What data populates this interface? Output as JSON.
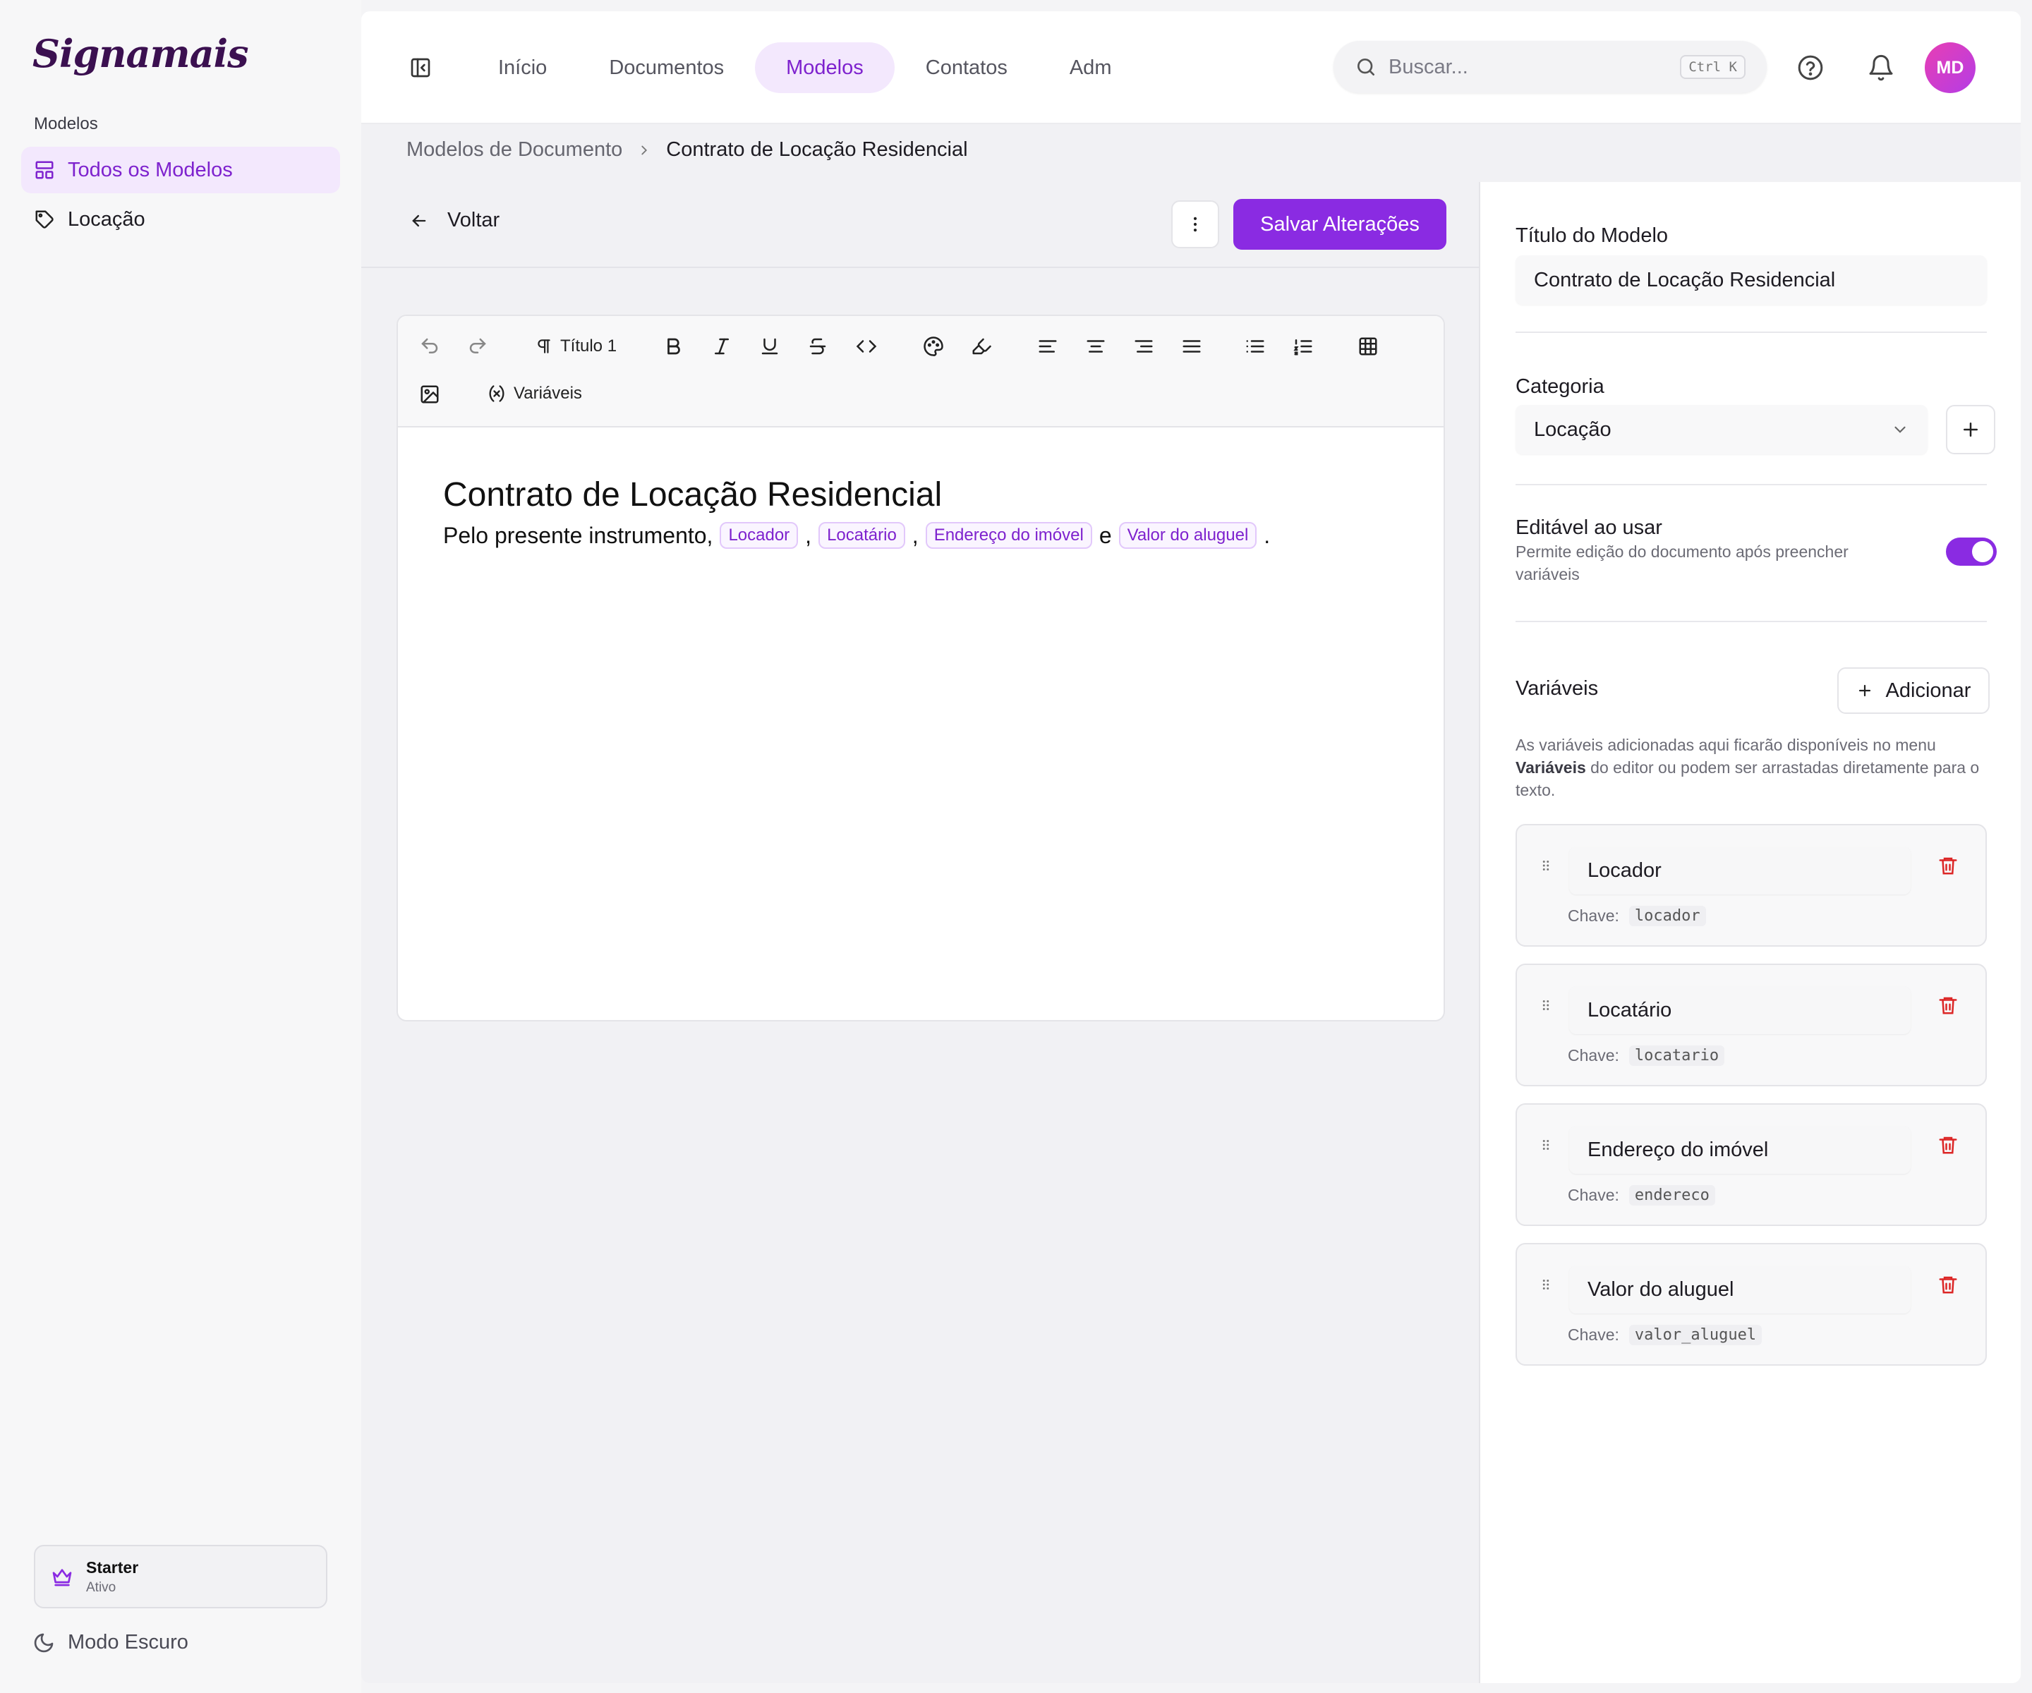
{
  "sidebar": {
    "logo": "Signamais",
    "section": "Modelos",
    "items": [
      {
        "label": "Todos os Modelos",
        "icon": "layout-icon",
        "active": true
      },
      {
        "label": "Locação",
        "icon": "tag-icon",
        "active": false
      }
    ],
    "plan": {
      "name": "Starter",
      "status": "Ativo"
    },
    "dark_mode_label": "Modo Escuro"
  },
  "topbar": {
    "nav": [
      "Início",
      "Documentos",
      "Modelos",
      "Contatos",
      "Adm"
    ],
    "active_nav": "Modelos",
    "search_placeholder": "Buscar...",
    "search_shortcut": "Ctrl K",
    "avatar_initials": "MD"
  },
  "breadcrumb": {
    "parent": "Modelos de Documento",
    "current": "Contrato de Locação Residencial"
  },
  "editor": {
    "back_label": "Voltar",
    "save_label": "Salvar Alterações",
    "toolbar": {
      "heading_label": "Título 1",
      "variables_label": "Variáveis"
    },
    "doc_title": "Contrato de Locação Residencial",
    "doc_intro": "Pelo presente instrumento,",
    "chips": [
      "Locador",
      "Locatário",
      "Endereço do imóvel",
      "Valor do aluguel"
    ],
    "sep_comma": ",",
    "sep_and": "e",
    "sep_period": "."
  },
  "panel": {
    "title_label": "Título do Modelo",
    "title_value": "Contrato de Locação Residencial",
    "category_label": "Categoria",
    "category_value": "Locação",
    "editable_label": "Editável ao usar",
    "editable_desc": "Permite edição do documento após preencher variáveis",
    "editable_on": true,
    "variables_label": "Variáveis",
    "add_label": "Adicionar",
    "variables_desc_1": "As variáveis adicionadas aqui ficarão disponíveis no menu",
    "variables_desc_bold": "Variáveis",
    "variables_desc_2": "do editor ou podem ser arrastadas diretamente para o texto.",
    "key_label": "Chave:",
    "variables": [
      {
        "name": "Locador",
        "key": "locador"
      },
      {
        "name": "Locatário",
        "key": "locatario"
      },
      {
        "name": "Endereço do imóvel",
        "key": "endereco"
      },
      {
        "name": "Valor do aluguel",
        "key": "valor_aluguel"
      }
    ]
  },
  "colors": {
    "accent": "#8a2be2",
    "accent_text": "#7e22ce",
    "accent_bg": "#f3e8fd",
    "danger": "#dc2626"
  }
}
